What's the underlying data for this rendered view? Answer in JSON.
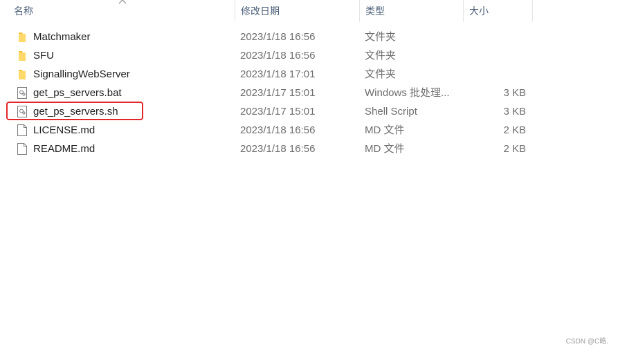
{
  "columns": {
    "name": "名称",
    "date": "修改日期",
    "type": "类型",
    "size": "大小"
  },
  "sort_indicator": "chevron-up-icon",
  "files": [
    {
      "name": "Matchmaker",
      "date": "2023/1/18 16:56",
      "type": "文件夹",
      "size": "",
      "icon": "folder-icon"
    },
    {
      "name": "SFU",
      "date": "2023/1/18 16:56",
      "type": "文件夹",
      "size": "",
      "icon": "folder-icon"
    },
    {
      "name": "SignallingWebServer",
      "date": "2023/1/18 17:01",
      "type": "文件夹",
      "size": "",
      "icon": "folder-icon"
    },
    {
      "name": "get_ps_servers.bat",
      "date": "2023/1/17 15:01",
      "type": "Windows 批处理...",
      "size": "3 KB",
      "icon": "script-file-icon"
    },
    {
      "name": "get_ps_servers.sh",
      "date": "2023/1/17 15:01",
      "type": "Shell Script",
      "size": "3 KB",
      "icon": "script-file-icon"
    },
    {
      "name": "LICENSE.md",
      "date": "2023/1/18 16:56",
      "type": "MD 文件",
      "size": "2 KB",
      "icon": "file-icon"
    },
    {
      "name": "README.md",
      "date": "2023/1/18 16:56",
      "type": "MD 文件",
      "size": "2 KB",
      "icon": "file-icon"
    }
  ],
  "highlighted_file": "get_ps_servers.sh",
  "colors": {
    "folder": "#f5c242",
    "highlight_border": "#e3262a",
    "header_text": "#4c607a"
  },
  "watermark": "CSDN @C皓."
}
